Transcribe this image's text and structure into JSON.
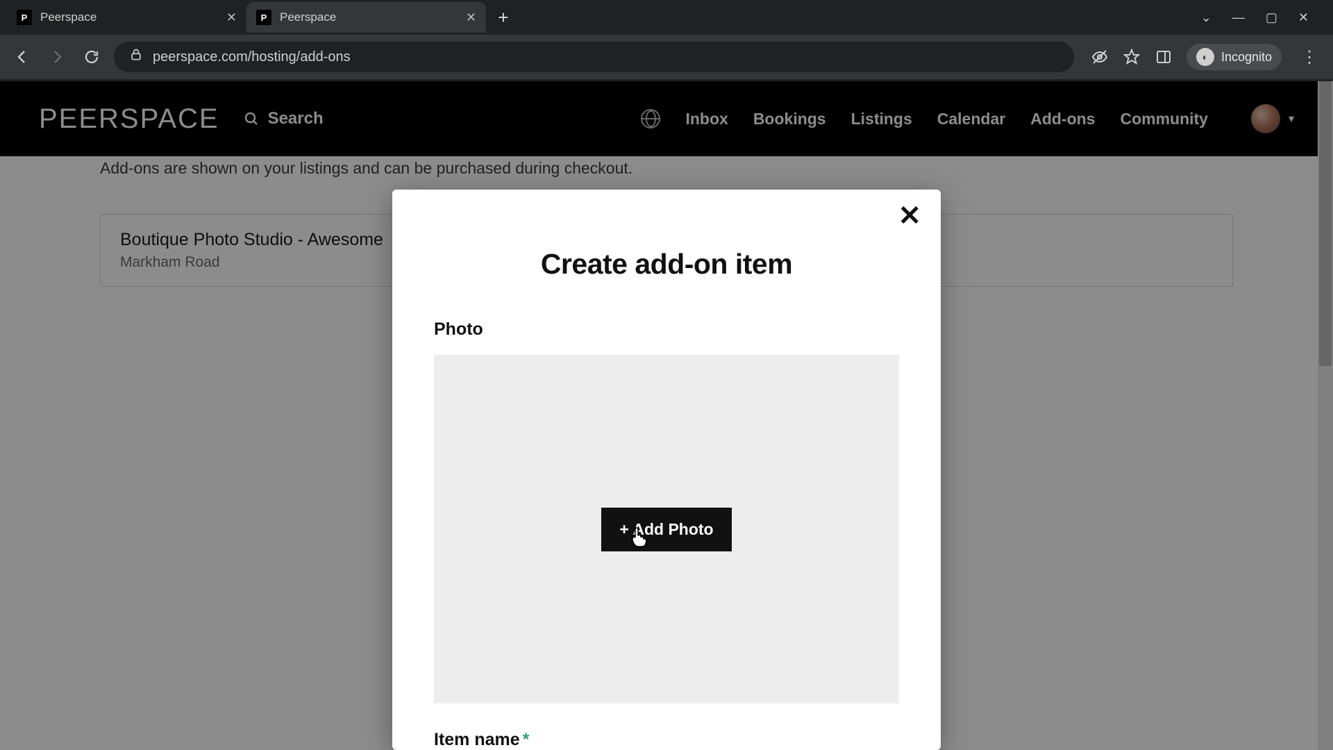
{
  "browser": {
    "tabs": [
      {
        "favicon_letter": "P",
        "title": "Peerspace",
        "active": false
      },
      {
        "favicon_letter": "P",
        "title": "Peerspace",
        "active": true
      }
    ],
    "url": "peerspace.com/hosting/add-ons",
    "incognito_label": "Incognito"
  },
  "header": {
    "brand": "PEERSPACE",
    "search_label": "Search",
    "nav": [
      "Inbox",
      "Bookings",
      "Listings",
      "Calendar",
      "Add-ons",
      "Community"
    ]
  },
  "page": {
    "blurb": "Add-ons are shown on your listings and can be purchased during checkout.",
    "card": {
      "title": "Boutique Photo Studio - Awesome",
      "subtitle": "Markham Road"
    }
  },
  "modal": {
    "title": "Create add-on item",
    "photo_label": "Photo",
    "add_photo_label": "+ Add Photo",
    "item_name_label": "Item name",
    "required_mark": "*"
  }
}
